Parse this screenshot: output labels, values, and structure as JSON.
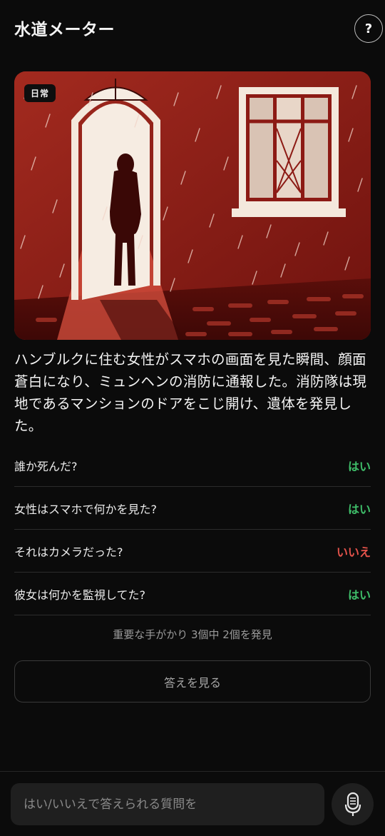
{
  "header": {
    "title": "水道メーター",
    "help_label": "?"
  },
  "hero": {
    "tag": "日常",
    "image_icon": "woman-in-doorway-rain-illustration"
  },
  "story": {
    "text": "ハンブルクに住む女性がスマホの画面を見た瞬間、顔面蒼白になり、ミュンヘンの消防に通報した。消防隊は現地であるマンションのドアをこじ開け、遺体を発見した。"
  },
  "qa": [
    {
      "question": "誰か死んだ?",
      "answer": "はい",
      "status": "yes"
    },
    {
      "question": "女性はスマホで何かを見た?",
      "answer": "はい",
      "status": "yes"
    },
    {
      "question": "それはカメラだった?",
      "answer": "いいえ",
      "status": "no"
    },
    {
      "question": "彼女は何かを監視してた?",
      "answer": "はい",
      "status": "yes"
    }
  ],
  "progress": {
    "text": "重要な手がかり 3個中 2個を発見",
    "found": 2,
    "total": 3
  },
  "actions": {
    "show_answer_label": "答えを見る"
  },
  "input": {
    "placeholder": "はい/いいえで答えられる質問を",
    "value": ""
  },
  "icons": {
    "help": "question-mark-icon",
    "mic": "microphone-icon"
  },
  "colors": {
    "background": "#0b0b0b",
    "yes": "#3fbf6a",
    "no": "#e5534b",
    "hero_red": "#8c1a14"
  }
}
